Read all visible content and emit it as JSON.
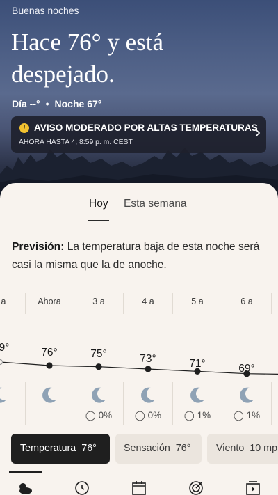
{
  "header": {
    "greeting": "Buenas noches",
    "headline": "Hace 76° y está despejado.",
    "day": "Día --°",
    "separator": "•",
    "night": "Noche 67°"
  },
  "alert": {
    "icon": "warning-icon",
    "title": "AVISO MODERADO POR ALTAS TEMPERATURAS",
    "subtitle": "AHORA HASTA 4, 8:59 p. m. CEST"
  },
  "tabs": [
    {
      "label": "Hoy",
      "selected": true
    },
    {
      "label": "Esta semana",
      "selected": false
    }
  ],
  "forecast": {
    "label": "Previsión:",
    "text": " La temperatura baja de esta noche será casi la misma que la de anoche."
  },
  "hourly": [
    {
      "hour": "a",
      "temp": "9°",
      "temp_value": 79,
      "precip": ""
    },
    {
      "hour": "Ahora",
      "temp": "76°",
      "temp_value": 76,
      "precip": ""
    },
    {
      "hour": "3 a",
      "temp": "75°",
      "temp_value": 75,
      "precip": "0%"
    },
    {
      "hour": "4 a",
      "temp": "73°",
      "temp_value": 73,
      "precip": "0%"
    },
    {
      "hour": "5 a",
      "temp": "71°",
      "temp_value": 71,
      "precip": "1%"
    },
    {
      "hour": "6 a",
      "temp": "69°",
      "temp_value": 69,
      "precip": "1%"
    }
  ],
  "metrics": [
    {
      "label": "Temperatura",
      "value": "76°",
      "active": true
    },
    {
      "label": "Sensación",
      "value": "76°",
      "active": false
    },
    {
      "label": "Viento",
      "value": "10 mp",
      "active": false
    }
  ],
  "bottom_nav": [
    {
      "icon": "weather-today-icon",
      "selected": true
    },
    {
      "icon": "clock-icon",
      "selected": false
    },
    {
      "icon": "calendar-icon",
      "selected": false
    },
    {
      "icon": "radar-icon",
      "selected": false
    },
    {
      "icon": "video-icon",
      "selected": false
    }
  ],
  "colors": {
    "alert_yellow": "#f2c230",
    "sheet_bg": "#f8f3ee",
    "moon": "#8fa2b5",
    "active_pill": "#1f1f1f"
  }
}
